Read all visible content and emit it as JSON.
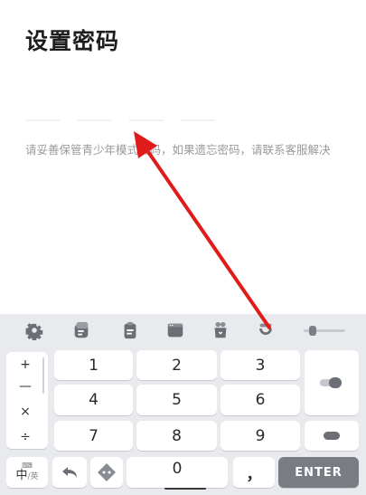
{
  "page": {
    "title": "设置密码",
    "hint": "请妥善保管青少年模式密码，如果遗忘密码，请联系客服解决"
  },
  "keyboard": {
    "symbols": [
      "+",
      "—",
      "×",
      "÷"
    ],
    "rows": [
      [
        "1",
        "2",
        "3"
      ],
      [
        "4",
        "5",
        "6"
      ],
      [
        "7",
        "8",
        "9"
      ]
    ],
    "zero": "0",
    "punct": "，",
    "enter": "ENTER",
    "lang_main": "中",
    "lang_sep": "/",
    "lang_alt": "英"
  },
  "colors": {
    "keyboard_bg": "#e9eaee",
    "key_bg": "#ffffff",
    "enter_bg": "#7a7c84",
    "arrow": "#e11a1a"
  },
  "icons": [
    "settings-gear-icon",
    "sticker-icon",
    "clipboard-icon",
    "keyboard-layout-icon",
    "bag-icon",
    "swipe-icon",
    "undo-icon",
    "emoji-icon"
  ]
}
